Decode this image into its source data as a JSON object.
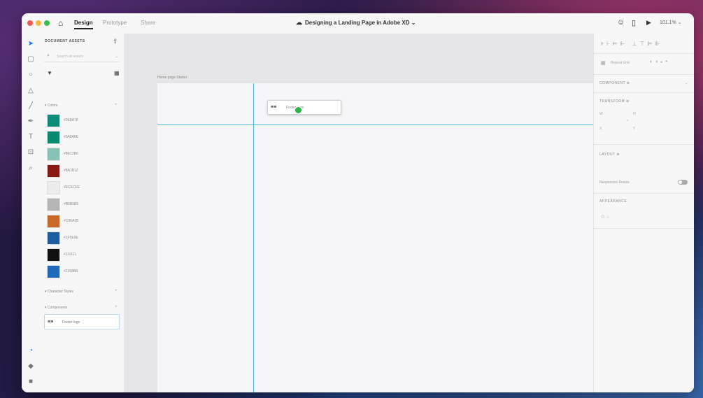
{
  "titlebar": {
    "tabs": [
      "Design",
      "Prototype",
      "Share"
    ],
    "doc_title": "Designing a Landing Page in Adobe XD",
    "zoom": "101.1%"
  },
  "assets": {
    "title": "DOCUMENT ASSETS",
    "search_placeholder": "Search all assets",
    "colors_header": "Colors",
    "colors": [
      {
        "hex": "#0E8A78",
        "label": "#0E8A78"
      },
      {
        "hex": "#0A8A6E",
        "label": "#0A8A6E"
      },
      {
        "hex": "#86C2B6",
        "label": "#86C2B6"
      },
      {
        "hex": "#8A1B12",
        "label": "#8A1B12"
      },
      {
        "hex": "#ECECEE",
        "label": "#ECECEE"
      },
      {
        "hex": "#B5B5B5",
        "label": "#B5B5B5"
      },
      {
        "hex": "#C96A2B",
        "label": "#C96A2B"
      },
      {
        "hex": "#1F5E9E",
        "label": "#1F5E9E"
      },
      {
        "hex": "#111111",
        "label": "#111111"
      },
      {
        "hex": "#2268B8",
        "label": "#2268B8"
      }
    ],
    "char_styles_header": "Character Styles",
    "components_header": "Components",
    "component_label": "Footer logo",
    "component_thumb": "≋≋"
  },
  "canvas": {
    "artboard_label": "Home page Starter",
    "drag_label": "Footer logo",
    "drag_thumb": "≋≋"
  },
  "props": {
    "repeat_grid": "Repeat Grid",
    "component": "COMPONENT",
    "transform": "TRANSFORM",
    "layout": "LAYOUT",
    "responsive_resize": "Responsive Resize",
    "appearance": "APPEARANCE",
    "w_label": "W",
    "h_label": "H",
    "x_label": "X",
    "y_label": "Y"
  }
}
